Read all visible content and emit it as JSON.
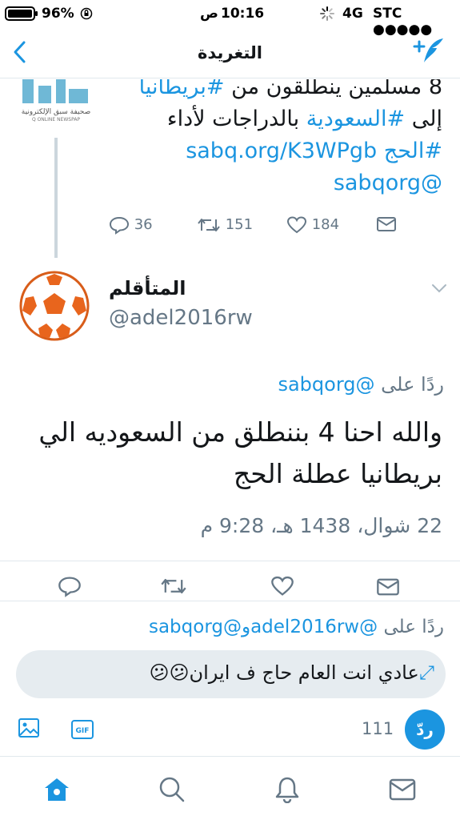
{
  "status_bar": {
    "battery": "96%",
    "time": "10:16",
    "ampm": "ص",
    "network": "4G",
    "carrier": "STC ●●●●●"
  },
  "nav": {
    "title": "التغريدة",
    "back_icon": "chevron-left-icon",
    "compose_icon": "compose-feather-icon"
  },
  "parent_tweet": {
    "logo_text": "صحيفة سبق الإلكترونية",
    "logo_sub": "Q ONLINE NEWSPAP",
    "line1_plain": "8 مسلمين ينطلقون من ",
    "line1_tag": "#بريطانيا",
    "line2_plain_start": "إلى ",
    "line2_tag": "#السعودية",
    "line2_plain_end": " بالدراجات لأداء",
    "line3_tag": "#الحج",
    "line3_link": "sabq.org/K3WPgb",
    "line4_mention": "@sabqorg",
    "replies": "36",
    "retweets": "151",
    "likes": "184"
  },
  "main_tweet": {
    "display_name": "المتأقلم",
    "handle": "@adel2016rw",
    "replying_label": "ردًا على",
    "replying_to": "@sabqorg",
    "text_line1": "والله احنا 4 بننطلق من السعوديه الي",
    "text_line2": "بريطانيا عطلة الحج",
    "timestamp": "22 شوال، 1438 هـ، 9:28 م"
  },
  "reply_bar": {
    "label_prefix": "ردًا على",
    "mention1": "@adel2016rw",
    "conj": "و",
    "mention2": "@sabqorg",
    "draft_text": "عادي  انت العام حاج ف ايران",
    "emoji": "😕😕",
    "char_count": "111",
    "reply_button": "ردّ"
  },
  "colors": {
    "accent": "#1b95e0",
    "text": "#14171a",
    "muted": "#657786",
    "divider": "#e1e8ed"
  }
}
